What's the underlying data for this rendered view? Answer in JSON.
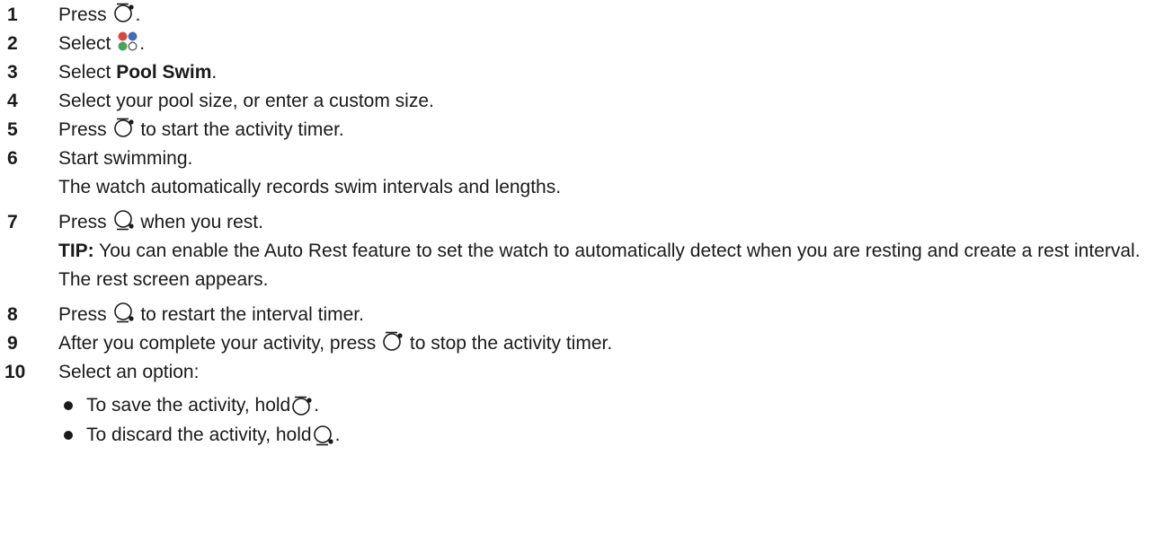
{
  "steps": [
    {
      "num": "1",
      "parts": [
        "Press ",
        "[start-stop-button-icon]",
        "."
      ]
    },
    {
      "num": "2",
      "before": "Select ",
      "after": "."
    },
    {
      "num": "3",
      "before": "Select ",
      "bold": "Pool Swim",
      "after": "."
    },
    {
      "num": "4",
      "text": "Select your pool size, or enter a custom size."
    },
    {
      "num": "5",
      "before": "Press ",
      "after": " to start the activity timer."
    },
    {
      "num": "6",
      "text": "Start swimming.",
      "detail": "The watch automatically records swim intervals and lengths."
    },
    {
      "num": "7",
      "before": "Press ",
      "after": " when you rest.",
      "tip_label": "TIP:",
      "tip_text": " You can enable the Auto Rest feature to set the watch to automatically detect when you are resting and create a rest interval.",
      "detail": "The rest screen appears."
    },
    {
      "num": "8",
      "before": "Press ",
      "after": " to restart the interval timer."
    },
    {
      "num": "9",
      "before": "After you complete your activity, press ",
      "after": " to stop the activity timer."
    },
    {
      "num": "10",
      "text": "Select an option:"
    }
  ],
  "options": [
    {
      "before": "To save the activity, hold ",
      "after": "."
    },
    {
      "before": "To discard the activity, hold ",
      "after": "."
    }
  ],
  "icons": {
    "start_stop": "start-stop-button-icon",
    "back_lap": "back-lap-button-icon",
    "activities": "activities-icon"
  },
  "colors": {
    "text": "#1a1a1a",
    "activities_red": "#d9473c",
    "activities_blue": "#3f6db3",
    "activities_green": "#4aa35b"
  }
}
